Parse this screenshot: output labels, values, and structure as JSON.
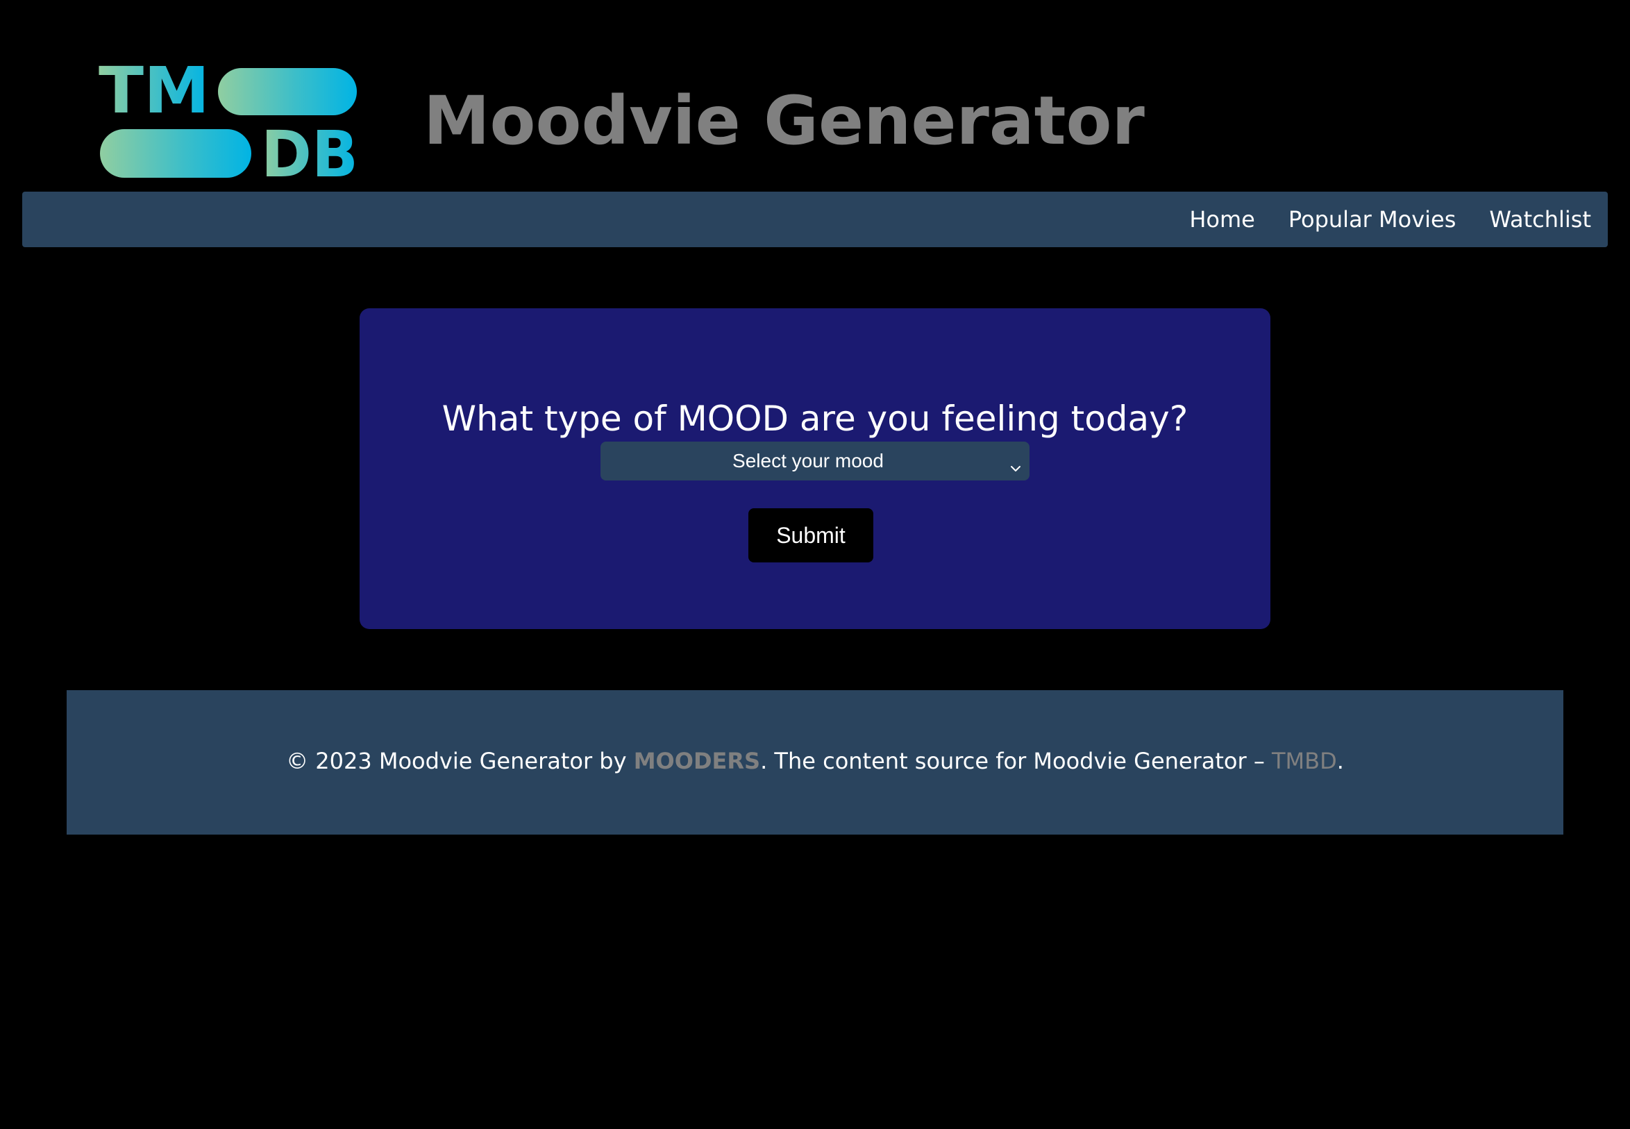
{
  "header": {
    "title": "Moodvie Generator",
    "logo": {
      "icon": "tmdb-logo-icon",
      "text_top": "TM",
      "text_bottom": "DB",
      "colors": [
        "#90cea1",
        "#3cbec9",
        "#01b4e4"
      ]
    }
  },
  "nav": {
    "items": [
      {
        "label": "Home"
      },
      {
        "label": "Popular Movies"
      },
      {
        "label": "Watchlist"
      }
    ]
  },
  "mood_form": {
    "question": "What type of MOOD are you feeling today?",
    "select_value": "Select your mood",
    "select_icon": "chevron-down-icon",
    "submit_label": "Submit"
  },
  "footer": {
    "prefix": "© 2023 Moodvie Generator by ",
    "author": "MOODERS",
    "middle": ". The content source for Moodvie Generator – ",
    "source": "TMBD",
    "suffix": "."
  },
  "colors": {
    "background": "#000000",
    "nav_bg": "#2a445e",
    "card_bg": "#1b1a71",
    "title_gray": "#808080",
    "text_white": "#ffffff"
  }
}
